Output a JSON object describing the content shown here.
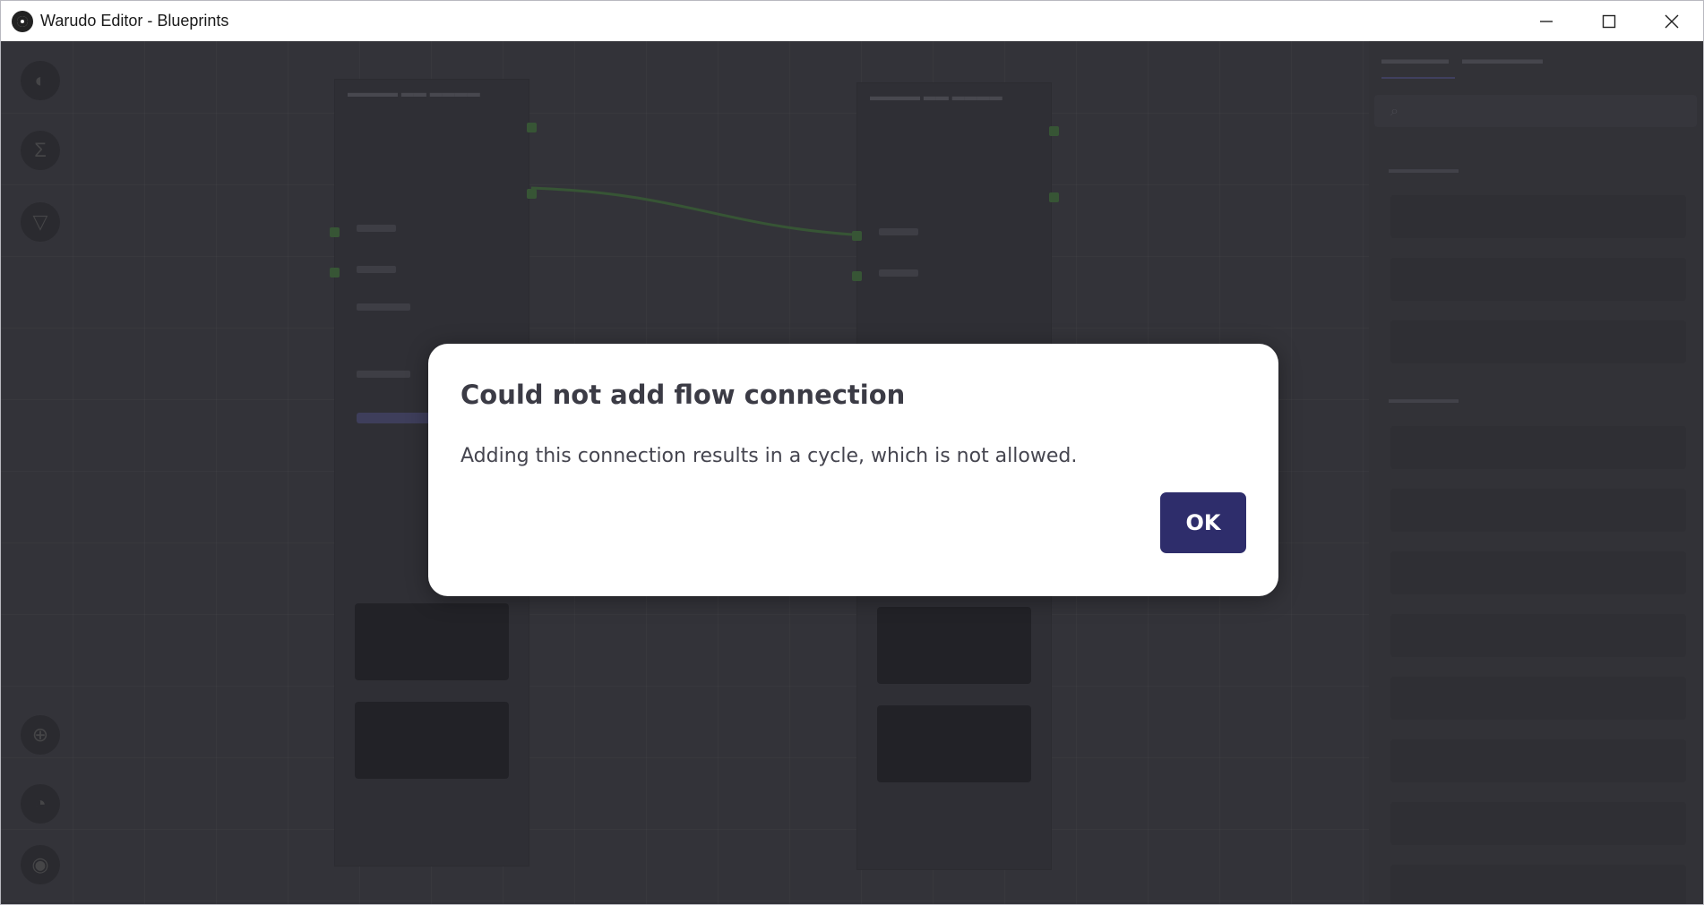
{
  "window": {
    "title": "Warudo Editor - Blueprints",
    "controls": {
      "minimize": "minimize-icon",
      "maximize": "maximize-icon",
      "close": "close-icon"
    }
  },
  "dialog": {
    "title": "Could not add flow connection",
    "message": "Adding this connection results in a cycle, which is not allowed.",
    "ok_label": "OK",
    "accent_color": "#2e2d6b"
  }
}
